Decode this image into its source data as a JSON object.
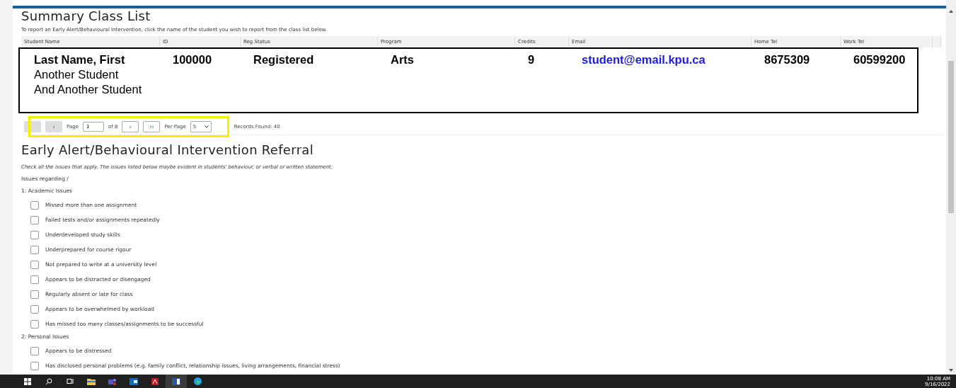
{
  "summary": {
    "title": "Summary Class List",
    "instructions": "To report an Early Alert/Behavioural Intervention, click the name of the student you wish to report from the class list below."
  },
  "table": {
    "columns": [
      "Student Name",
      "ID",
      "Reg Status",
      "Program",
      "Credits",
      "Email",
      "Home Tel",
      "Work Tel"
    ],
    "rows": [
      {
        "student_name": "Last Name, First",
        "id": "100000",
        "reg_status": "Registered",
        "program": "Arts",
        "credits": "9",
        "email": "student@email.kpu.ca",
        "home_tel": "8675309",
        "work_tel": "60599200",
        "emphasized": true
      },
      {
        "student_name": "Another Student",
        "emphasized": false
      },
      {
        "student_name": "And Another Student",
        "emphasized": false
      }
    ]
  },
  "pagination": {
    "first_disabled": true,
    "prev_label": "‹",
    "prev_disabled": true,
    "page_label": "Page",
    "page_value": "1",
    "of_label": "of 8",
    "next_label": "›",
    "per_page_label": "Per Page",
    "per_page_value": "5",
    "records_found": "Records Found: 40",
    "highlighted": true
  },
  "referral": {
    "title": "Early Alert/Behavioural Intervention Referral",
    "instructions": "Check all the issues that apply. The issues listed below maybe evident in students' behaviour, or verbal or written statement.",
    "issues_label": "Issues regarding /",
    "groups": [
      {
        "title": "1: Academic Issues",
        "items": [
          {
            "label": "Missed more than one assignment",
            "checked": false
          },
          {
            "label": "Failed tests and/or assignments repeatedly",
            "checked": false
          },
          {
            "label": "Underdeveloped study skills",
            "checked": false
          },
          {
            "label": "Underprepared for course rigour",
            "checked": false
          },
          {
            "label": "Not prepared to write at a university level",
            "checked": false
          },
          {
            "label": "Appears to be distracted or disengaged",
            "checked": false
          },
          {
            "label": "Regularly absent or late for class",
            "checked": false
          },
          {
            "label": "Appears to be overwhelmed by workload",
            "checked": false
          },
          {
            "label": "Has missed too many classes/assignments to be successful",
            "checked": false
          }
        ]
      },
      {
        "title": "2: Personal Issues",
        "items": [
          {
            "label": "Appears to be distressed",
            "checked": false
          },
          {
            "label": "Has disclosed personal problems (e.g. family conflict, relationship issues, living arrangements, financial stress)",
            "checked": false
          }
        ]
      }
    ]
  },
  "taskbar": {
    "time": "10:08 AM",
    "date": "9/16/2022"
  }
}
